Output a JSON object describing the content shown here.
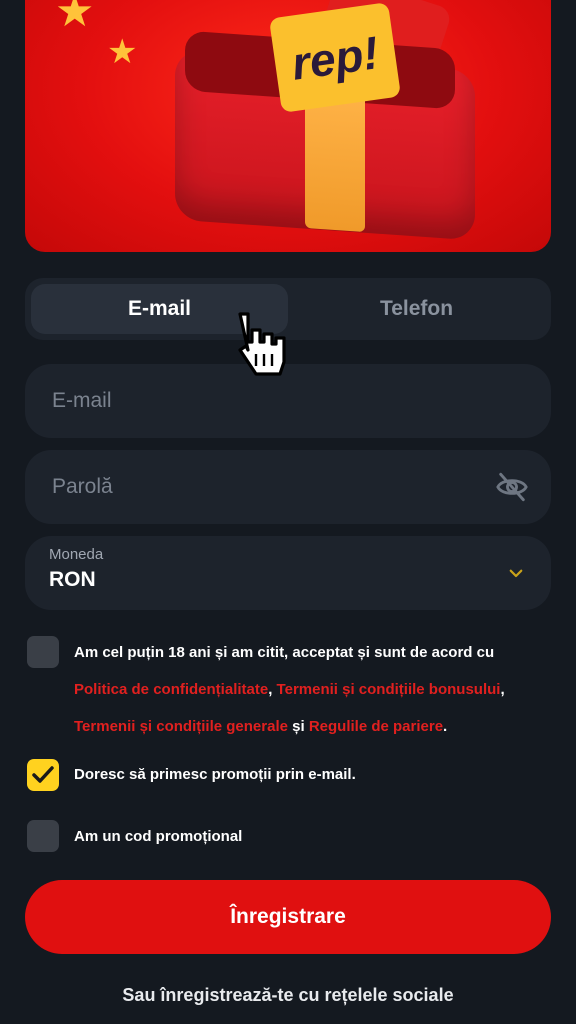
{
  "banner": {
    "ticket_text": "rep!"
  },
  "tabs": [
    {
      "label": "E-mail",
      "active": true
    },
    {
      "label": "Telefon",
      "active": false
    }
  ],
  "form": {
    "email_placeholder": "E-mail",
    "password_placeholder": "Parolă",
    "currency_label": "Moneda",
    "currency_value": "RON"
  },
  "consent": {
    "age_prefix": "Am cel puțin 18 ani și am citit, acceptat și sunt de acord cu",
    "link_privacy": "Politica de confidențialitate",
    "sep1": ",",
    "link_bonus_terms": "Termenii și condițiile bonusului",
    "sep2": ",",
    "link_general_terms": "Termenii și condițiile generale",
    "and": "și",
    "link_betting_rules": "Regulile de pariere",
    "end": ".",
    "age_checked": false,
    "promo_email_label": "Doresc să primesc promoții prin e-mail.",
    "promo_email_checked": true,
    "promo_code_label": "Am un cod promoțional",
    "promo_code_checked": false
  },
  "register_label": "Înregistrare",
  "social_label": "Sau înregistrează-te cu rețelele sociale",
  "colors": {
    "background": "#141920",
    "field": "#1d232c",
    "accent_red": "#e01010",
    "accent_yellow": "#ffd21f",
    "link_red": "#e1201f"
  },
  "icons": [
    "eye-off-icon",
    "chevron-down-icon",
    "hand-pointer-cursor-icon",
    "checkmark-icon",
    "star-icon"
  ]
}
